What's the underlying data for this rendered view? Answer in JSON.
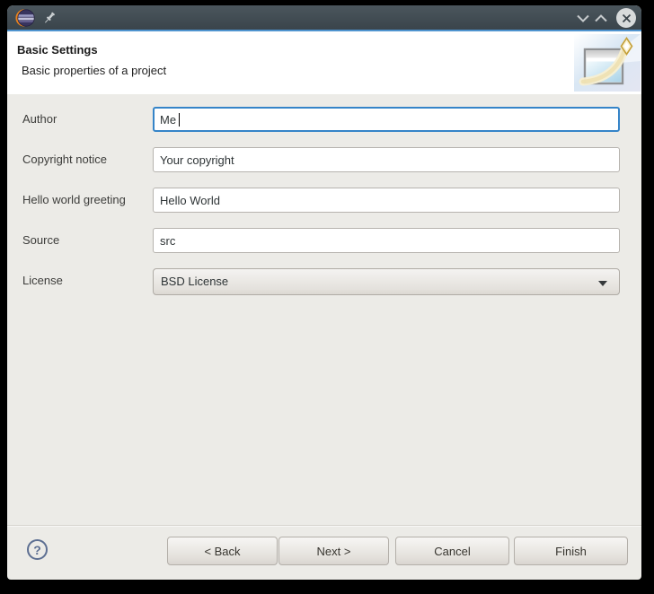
{
  "titlebar": {
    "app_icon": "eclipse-logo",
    "pin_icon": "pushpin",
    "controls": {
      "minimize": "chevron-down",
      "maximize": "chevron-up",
      "close": "circle-x"
    }
  },
  "header": {
    "title": "Basic Settings",
    "subtitle": "Basic properties of a project",
    "banner_icon": "new-wizard-window-sparkle"
  },
  "form": {
    "fields": [
      {
        "label": "Author",
        "value": "Me",
        "type": "text",
        "focused": true
      },
      {
        "label": "Copyright notice",
        "value": "Your copyright",
        "type": "text",
        "focused": false
      },
      {
        "label": "Hello world greeting",
        "value": "Hello World",
        "type": "text",
        "focused": false
      },
      {
        "label": "Source",
        "value": "src",
        "type": "text",
        "focused": false
      },
      {
        "label": "License",
        "value": "BSD License",
        "type": "select",
        "focused": false
      }
    ]
  },
  "footer": {
    "help_label": "?",
    "buttons": [
      {
        "label": "< Back"
      },
      {
        "label": "Next >"
      },
      {
        "label": "Cancel"
      },
      {
        "label": "Finish"
      }
    ]
  },
  "colors": {
    "desktop_background": "#000000",
    "titlebar": "#414b52",
    "titlebar_accent_line": "#4f94cf",
    "header_background": "#ffffff",
    "body_background": "#ecebe7",
    "focus_border": "#3584c8",
    "input_border": "#b6b3ae",
    "button_face": "#e8e5e1",
    "help_icon": "#5d6f92"
  }
}
